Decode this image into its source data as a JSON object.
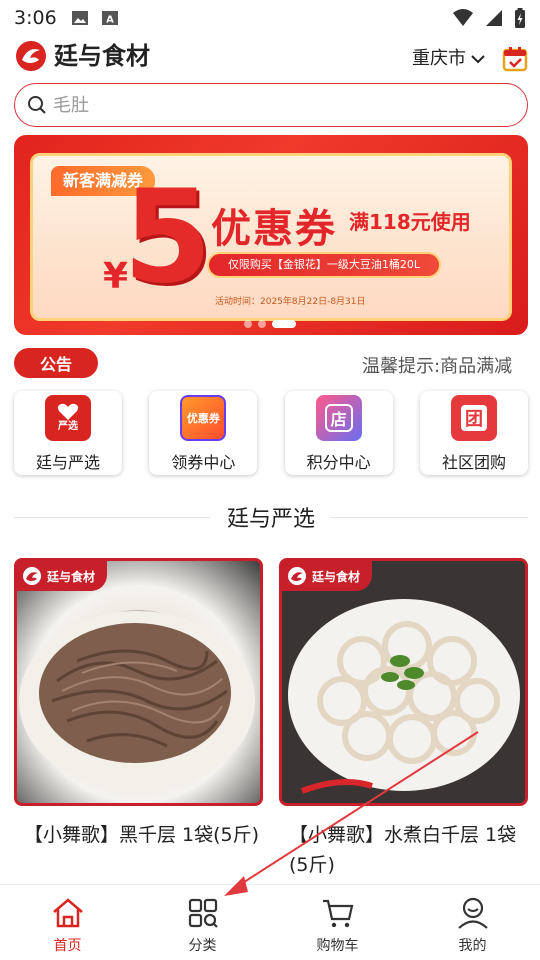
{
  "status_bar": {
    "time": "3:06"
  },
  "header": {
    "app_title": "廷与食材",
    "city": "重庆市"
  },
  "search": {
    "placeholder": "毛肚"
  },
  "banner": {
    "tag": "新客满减券",
    "amount": "5",
    "currency": "¥",
    "coupon_text": "优惠券",
    "condition": "满118元使用",
    "restriction": "仅限购买【金银花】一级大豆油1桶20L",
    "date": "活动时间：2025年8月22日-8月31日"
  },
  "notice": {
    "label": "公告",
    "text": "温馨提示:商品满减"
  },
  "quick_entries": [
    {
      "label": "廷与严选",
      "icon": "heart-select-icon",
      "icon_text": "严选",
      "color": "#d9251f"
    },
    {
      "label": "领券中心",
      "icon": "coupon-center-icon",
      "icon_text": "优惠券",
      "color": "#ff7a1a"
    },
    {
      "label": "积分中心",
      "icon": "points-store-icon",
      "icon_text": "店",
      "color": "#6a6ef0"
    },
    {
      "label": "社区团购",
      "icon": "group-buy-icon",
      "icon_text": "团",
      "color": "#e5393d"
    }
  ],
  "section_title": "廷与严选",
  "products": [
    {
      "badge": "廷与食材",
      "name": "【小舞歌】黑千层 1袋(5斤)"
    },
    {
      "badge": "廷与食材",
      "name": "【小舞歌】水煮白千层 1袋(5斤)"
    }
  ],
  "bottom_nav": [
    {
      "label": "首页",
      "icon": "home-icon",
      "active": true
    },
    {
      "label": "分类",
      "icon": "category-icon",
      "active": false
    },
    {
      "label": "购物车",
      "icon": "cart-icon",
      "active": false
    },
    {
      "label": "我的",
      "icon": "profile-icon",
      "active": false
    }
  ],
  "colors": {
    "brand_red": "#d9251f",
    "annotation_arrow": "#e0393e"
  }
}
